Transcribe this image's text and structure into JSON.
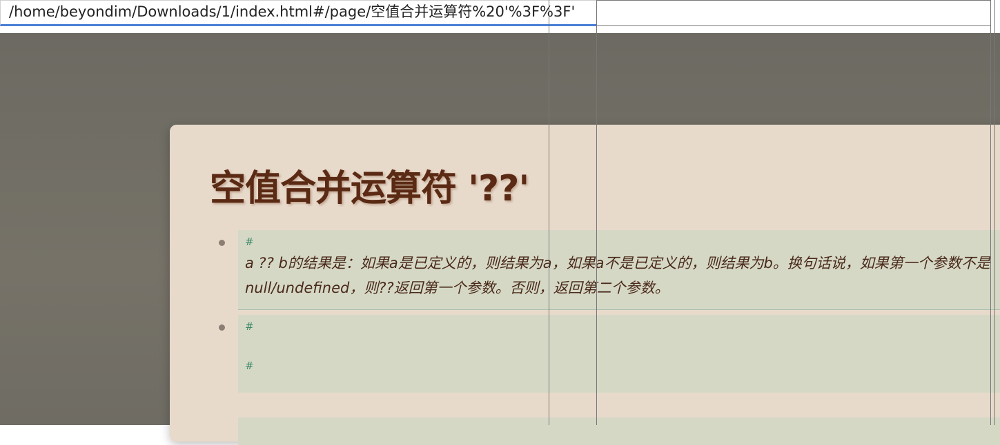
{
  "address_bar": {
    "url": "/home/beyondim/Downloads/1/index.html#/page/空值合并运算符%20'%3F%3F'"
  },
  "page": {
    "title": "空值合并运算符 '??'"
  },
  "blocks": [
    {
      "hash": "#",
      "text": "a ?? b的结果是：如果a是已定义的，则结果为a，如果a不是已定义的，则结果为b。换句话说，如果第一个参数不是null/undefined，则??返回第一个参数。否则，返回第二个参数。"
    },
    {
      "hash": "#",
      "hash2": "#"
    }
  ],
  "colors": {
    "backdrop": "#726f68",
    "card": "#e8dacb",
    "title": "#5b2a14",
    "block": "#d6d8c6",
    "hash": "#3f8a6a",
    "focus_border": "#4a80d6"
  }
}
